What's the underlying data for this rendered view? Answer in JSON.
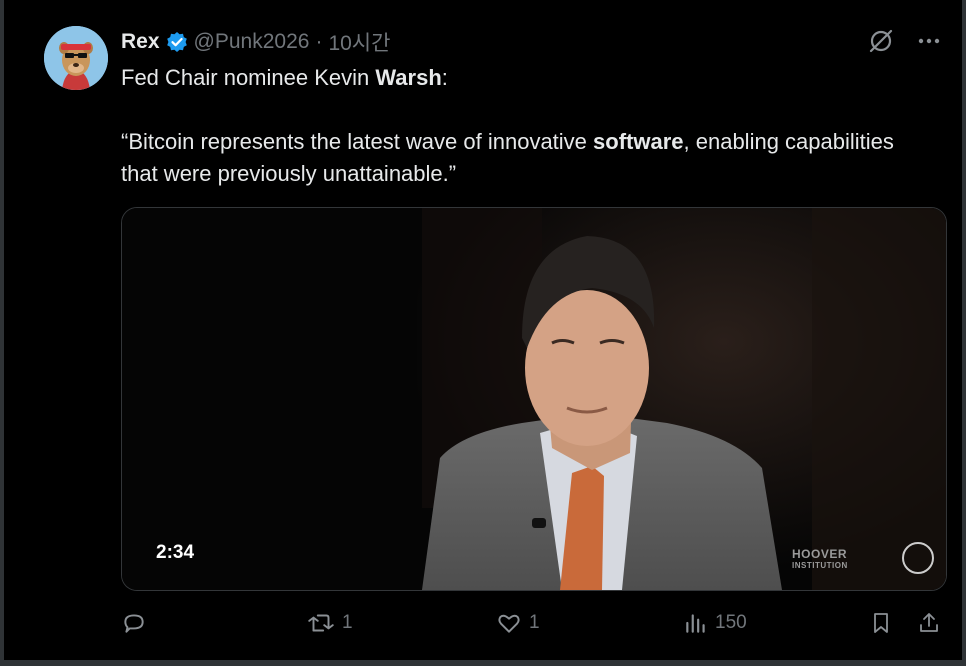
{
  "tweet": {
    "author_name": "Rex",
    "handle": "@Punk2026",
    "separator": "·",
    "time": "10시간",
    "line1_prefix": "Fed Chair nominee Kevin ",
    "line1_bold": "Warsh",
    "line1_suffix": ":",
    "quote_prefix": "“Bitcoin represents the latest wave of innovative ",
    "quote_bold": "software",
    "quote_suffix": ", enabling capabilities that were previously unattainable.”"
  },
  "media": {
    "duration": "2:34",
    "watermark_line1": "HOOVER",
    "watermark_line2": "INSTITUTION"
  },
  "actions": {
    "reply_count": "",
    "retweet_count": "1",
    "like_count": "1",
    "views_count": "150"
  },
  "icons": [
    "verified-badge-icon",
    "grok-icon",
    "more-icon",
    "reply-icon",
    "retweet-icon",
    "like-icon",
    "views-icon",
    "bookmark-icon",
    "share-icon"
  ],
  "colors": {
    "background": "#000000",
    "text": "#e7e9ea",
    "secondary": "#71767b",
    "verified": "#1d9bf0"
  }
}
